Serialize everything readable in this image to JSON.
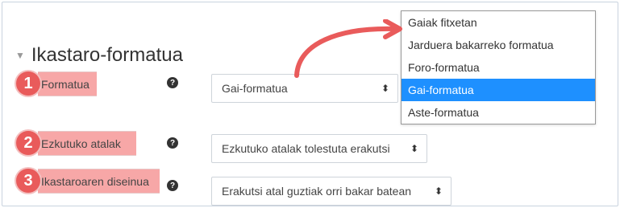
{
  "section": {
    "title": "Ikastaro-formatua"
  },
  "fields": [
    {
      "badge": "1",
      "label": "Formatua",
      "value": "Gai-formatua"
    },
    {
      "badge": "2",
      "label": "Ezkutuko atalak",
      "value": "Ezkutuko atalak tolestuta erakutsi"
    },
    {
      "badge": "3",
      "label": "Ikastaroaren diseinua",
      "value": "Erakutsi atal guztiak orri bakar batean"
    }
  ],
  "dropdown": {
    "options": [
      "Gaiak fitxetan",
      "Jarduera bakarreko formatua",
      "Foro-formatua",
      "Gai-formatua",
      "Aste-formatua"
    ],
    "selected_index": 3
  },
  "colors": {
    "accent": "#e95b5b",
    "highlight": "#f7a7a7",
    "selected": "#1e90ff"
  },
  "icons": {
    "help": "question-circle-icon",
    "collapse": "caret-down-icon",
    "select": "sort-arrows-icon"
  }
}
